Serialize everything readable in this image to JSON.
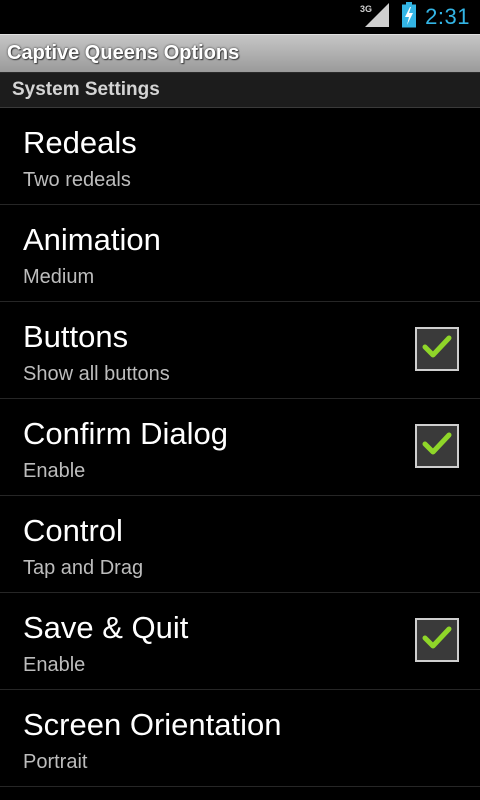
{
  "status_bar": {
    "network": "3G",
    "time": "2:31",
    "accent_color": "#33b5e5",
    "icons": [
      "signal-icon",
      "battery-charging-icon"
    ]
  },
  "title_bar": {
    "title": "Captive Queens Options"
  },
  "category": {
    "label": "System Settings"
  },
  "preferences": [
    {
      "title": "Redeals",
      "summary": "Two redeals",
      "type": "list"
    },
    {
      "title": "Animation",
      "summary": "Medium",
      "type": "list"
    },
    {
      "title": "Buttons",
      "summary": "Show all buttons",
      "type": "checkbox",
      "checked": true
    },
    {
      "title": "Confirm Dialog",
      "summary": "Enable",
      "type": "checkbox",
      "checked": true
    },
    {
      "title": "Control",
      "summary": "Tap and Drag",
      "type": "list"
    },
    {
      "title": "Save & Quit",
      "summary": "Enable",
      "type": "checkbox",
      "checked": true
    },
    {
      "title": "Screen Orientation",
      "summary": "Portrait",
      "type": "list"
    }
  ],
  "colors": {
    "check_green": "#8fd629"
  }
}
